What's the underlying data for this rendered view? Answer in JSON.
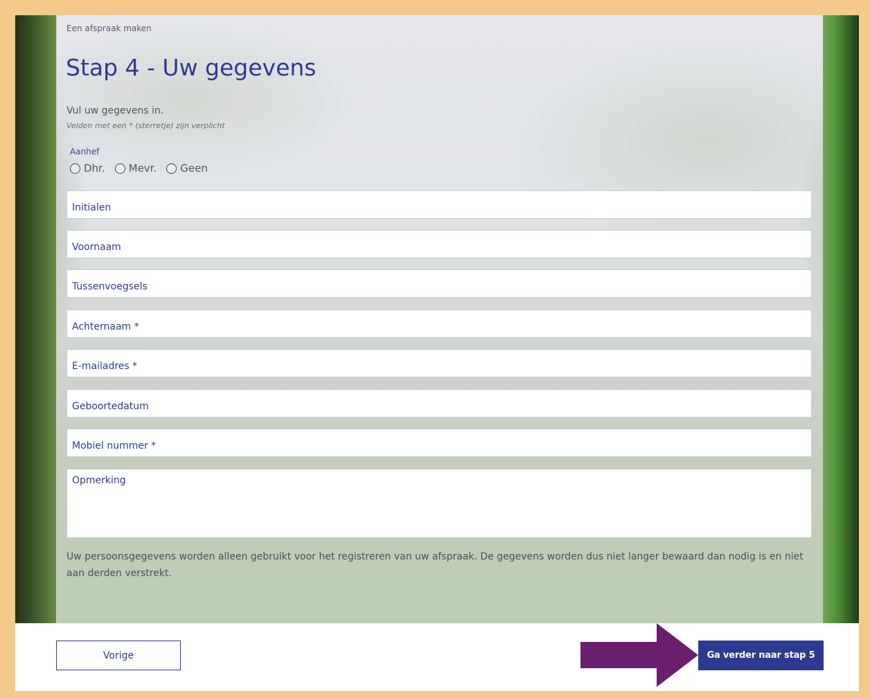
{
  "header": {
    "eyebrow": "Een afspraak maken",
    "title": "Stap 4 - Uw gegevens"
  },
  "intro": {
    "text": "Vul uw gegevens in.",
    "note": "Velden met een * (sterretje) zijn verplicht"
  },
  "salutation": {
    "label": "Aanhef",
    "options": [
      "Dhr.",
      "Mevr.",
      "Geen"
    ]
  },
  "fields": {
    "initials": "Initialen",
    "first_name": "Voornaam",
    "infix": "Tussenvoegsels",
    "last_name": "Achternaam *",
    "email": "E-mailadres *",
    "birthdate": "Geboortedatum",
    "mobile": "Mobiel nummer *",
    "remark": "Opmerking"
  },
  "privacy": "Uw persoonsgegevens worden alleen gebruikt voor het registreren van uw afspraak. De gegevens worden dus niet langer bewaard dan nodig is en niet aan derden verstrekt.",
  "footer": {
    "prev_label": "Vorige",
    "next_label": "Ga verder naar stap 5"
  },
  "colors": {
    "accent": "#2d3a8f",
    "frame": "#f5c98c",
    "arrow": "#6a1f6e"
  },
  "icons": {
    "arrow": "arrow-right-icon"
  }
}
